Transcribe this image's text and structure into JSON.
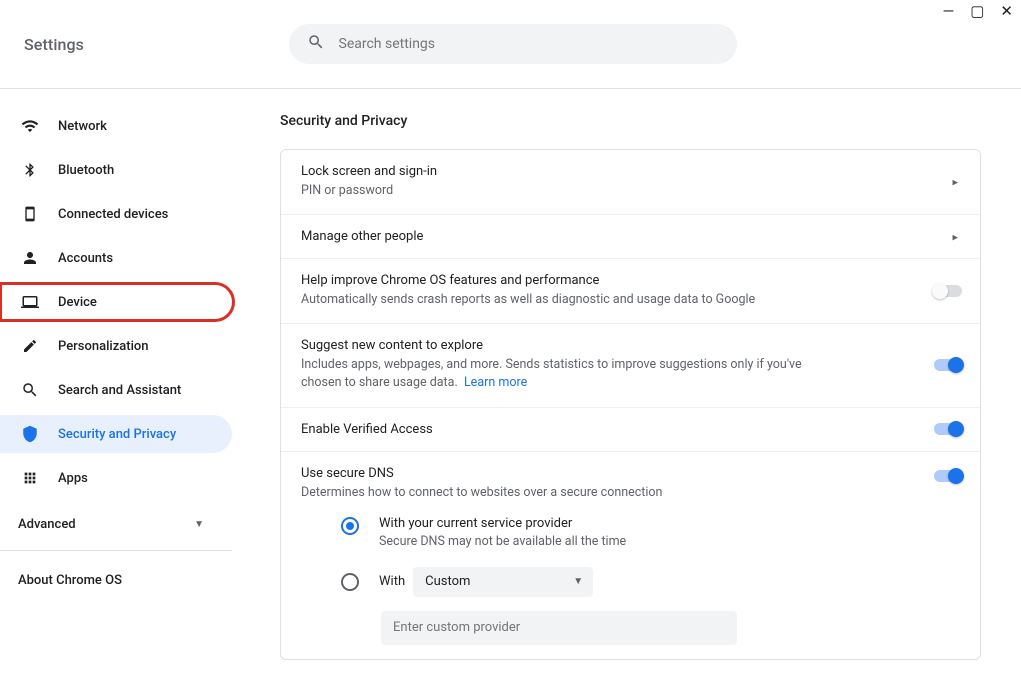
{
  "window_controls": {
    "minimize": "—",
    "maximize": "▢",
    "close": "✕"
  },
  "app_title": "Settings",
  "search": {
    "placeholder": "Search settings"
  },
  "sidebar": {
    "items": [
      {
        "label": "Network"
      },
      {
        "label": "Bluetooth"
      },
      {
        "label": "Connected devices"
      },
      {
        "label": "Accounts"
      },
      {
        "label": "Device"
      },
      {
        "label": "Personalization"
      },
      {
        "label": "Search and Assistant"
      },
      {
        "label": "Security and Privacy"
      },
      {
        "label": "Apps"
      }
    ],
    "advanced_label": "Advanced",
    "about_label": "About Chrome OS"
  },
  "content": {
    "section_title": "Security and Privacy",
    "lock": {
      "title": "Lock screen and sign-in",
      "sub": "PIN or password"
    },
    "manage": {
      "title": "Manage other people"
    },
    "crash": {
      "title": "Help improve Chrome OS features and performance",
      "sub": "Automatically sends crash reports as well as diagnostic and usage data to Google",
      "enabled": false
    },
    "suggest": {
      "title": "Suggest new content to explore",
      "sub": "Includes apps, webpages, and more. Sends statistics to improve suggestions only if you've chosen to share usage data.",
      "link": "Learn more",
      "enabled": true
    },
    "verified": {
      "title": "Enable Verified Access",
      "enabled": true
    },
    "dns": {
      "title": "Use secure DNS",
      "sub": "Determines how to connect to websites over a secure connection",
      "enabled": true,
      "opt1": {
        "title": "With your current service provider",
        "sub": "Secure DNS may not be available all the time"
      },
      "opt2": {
        "title": "With",
        "select": "Custom",
        "placeholder": "Enter custom provider"
      }
    }
  }
}
